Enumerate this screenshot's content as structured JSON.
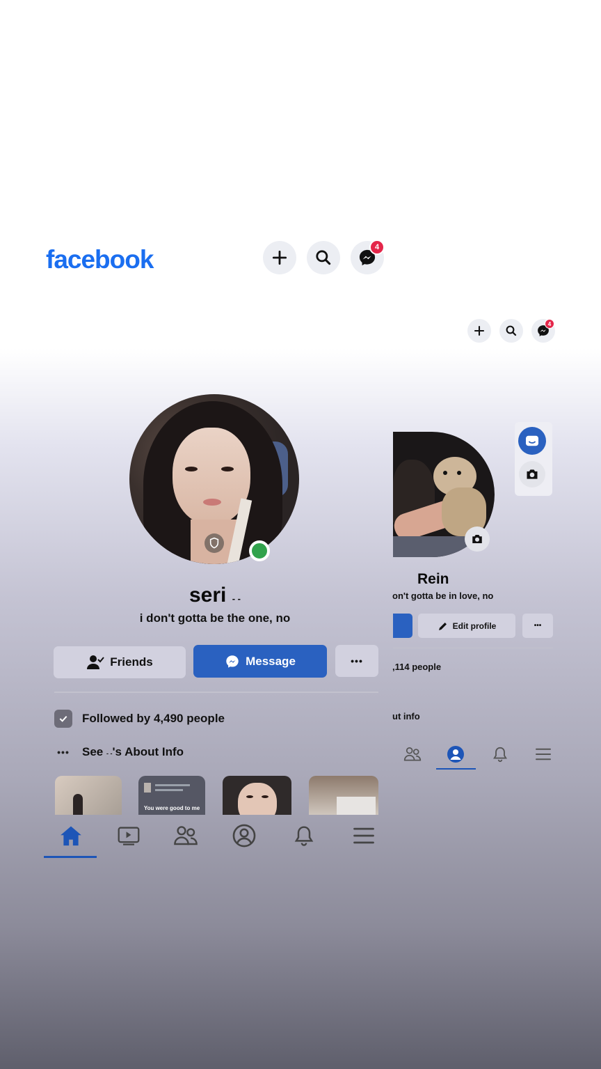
{
  "header": {
    "logo": "facebook",
    "messenger_badge": "4"
  },
  "header_small": {
    "messenger_badge": "4"
  },
  "profile": {
    "name": "seri",
    "name_suffix": "- -",
    "bio": "i don't gotta be the one, no",
    "friends_label": "Friends",
    "message_label": "Message",
    "more_label": "•••",
    "followed_by": "Followed by 4,490 people",
    "about_prefix": "See",
    "about_mid": "- -",
    "about_suffix": "'s About Info",
    "thumb_text_1": "You were good to me"
  },
  "profile_right": {
    "name": "Rein",
    "bio": "on't gotta be in love, no",
    "edit_label": "Edit profile",
    "more_label": "•••",
    "followed_partial": ",114 people",
    "about_partial": "ut info"
  },
  "colors": {
    "brand": "#1a6ef0",
    "message_button": "#2a61c0",
    "online": "#31a24c",
    "badge": "#e4264a"
  }
}
